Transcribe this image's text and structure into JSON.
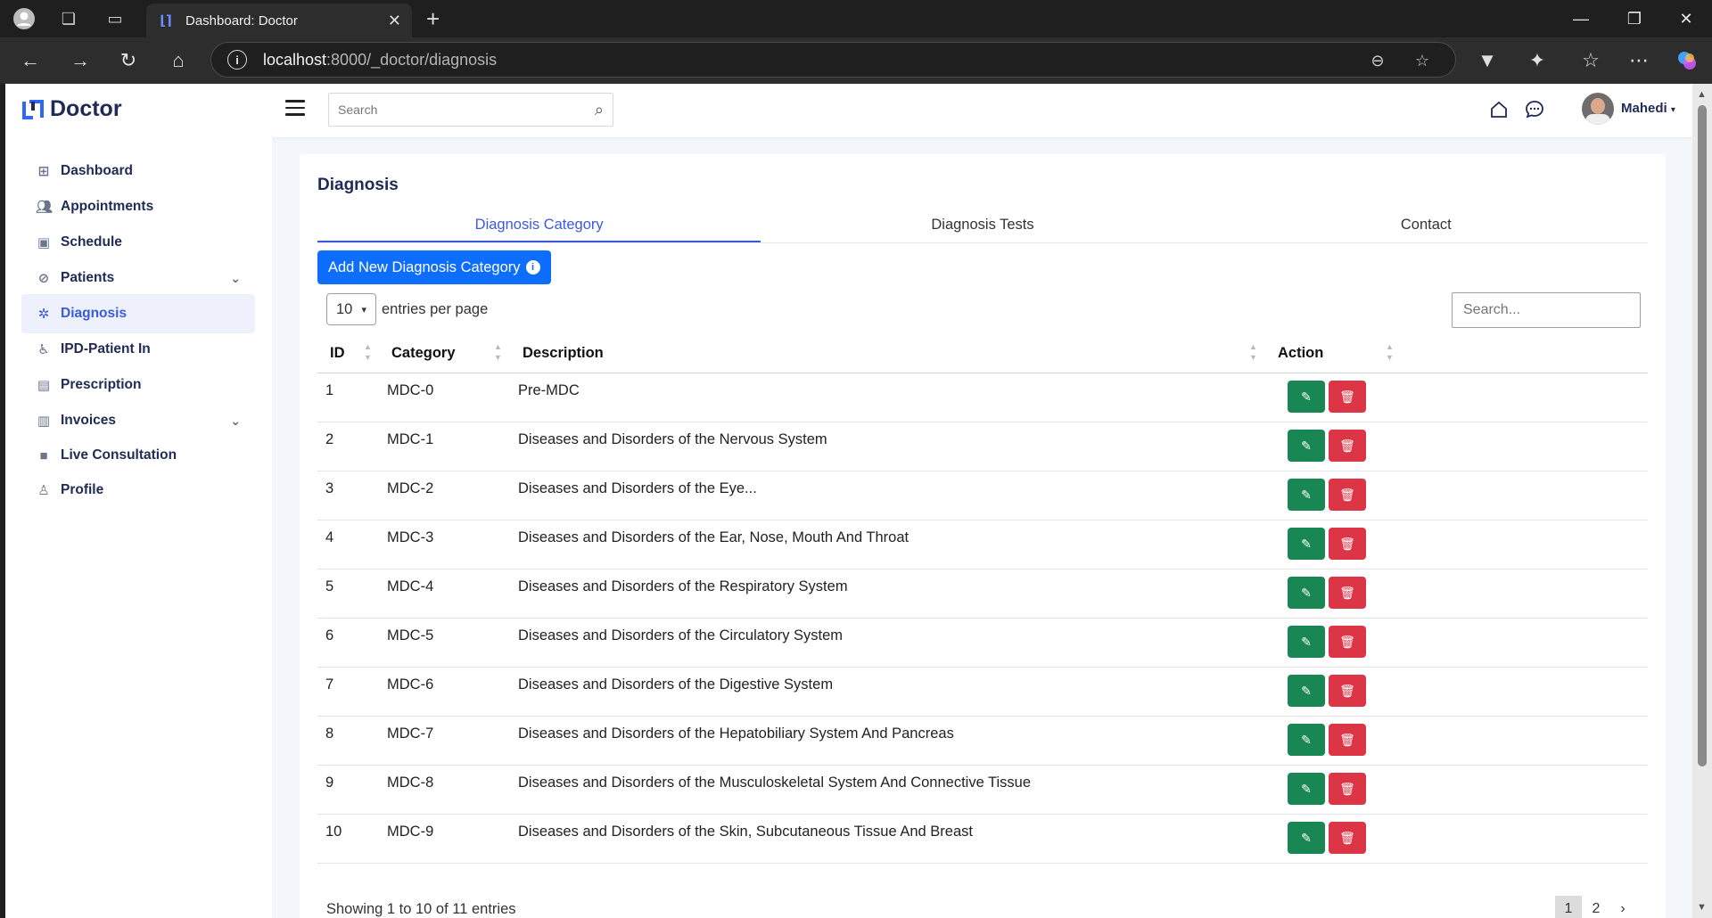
{
  "browser": {
    "tab_title": "Dashboard: Doctor",
    "url_host": "localhost",
    "url_path": ":8000/_doctor/diagnosis"
  },
  "app": {
    "brand": "Doctor",
    "search_placeholder": "Search",
    "user_name": "Mahedi"
  },
  "sidebar": {
    "items": [
      {
        "label": "Dashboard",
        "icon": "grid-icon"
      },
      {
        "label": "Appointments",
        "icon": "users-icon"
      },
      {
        "label": "Schedule",
        "icon": "calendar-icon"
      },
      {
        "label": "Patients",
        "icon": "bandage-icon"
      },
      {
        "label": "Diagnosis",
        "icon": "virus-icon"
      },
      {
        "label": "IPD-Patient In",
        "icon": "wheelchair-icon"
      },
      {
        "label": "Prescription",
        "icon": "prescription-icon"
      },
      {
        "label": "Invoices",
        "icon": "invoice-icon"
      },
      {
        "label": "Live Consultation",
        "icon": "video-icon"
      },
      {
        "label": "Profile",
        "icon": "user-icon"
      }
    ]
  },
  "page": {
    "title": "Diagnosis",
    "tabs": [
      "Diagnosis Category",
      "Diagnosis Tests",
      "Contact"
    ],
    "add_button": "Add New Diagnosis Category",
    "per_page_value": "10",
    "per_page_label": "entries per page",
    "table_search_placeholder": "Search...",
    "columns": [
      "ID",
      "Category",
      "Description",
      "Action"
    ],
    "rows": [
      {
        "id": "1",
        "category": "MDC-0",
        "description": "Pre-MDC"
      },
      {
        "id": "2",
        "category": "MDC-1",
        "description": "Diseases and Disorders of the Nervous System"
      },
      {
        "id": "3",
        "category": "MDC-2",
        "description": "Diseases and Disorders of the Eye..."
      },
      {
        "id": "4",
        "category": "MDC-3",
        "description": "Diseases and Disorders of the Ear, Nose, Mouth And Throat"
      },
      {
        "id": "5",
        "category": "MDC-4",
        "description": "Diseases and Disorders of the Respiratory System"
      },
      {
        "id": "6",
        "category": "MDC-5",
        "description": "Diseases and Disorders of the Circulatory System"
      },
      {
        "id": "7",
        "category": "MDC-6",
        "description": "Diseases and Disorders of the Digestive System"
      },
      {
        "id": "8",
        "category": "MDC-7",
        "description": "Diseases and Disorders of the Hepatobiliary System And Pancreas"
      },
      {
        "id": "9",
        "category": "MDC-8",
        "description": "Diseases and Disorders of the Musculoskeletal System And Connective Tissue"
      },
      {
        "id": "10",
        "category": "MDC-9",
        "description": "Diseases and Disorders of the Skin, Subcutaneous Tissue And Breast"
      }
    ],
    "footer_info": "Showing 1 to 10 of 11 entries",
    "pages": [
      "1",
      "2",
      "›"
    ]
  },
  "colors": {
    "accent": "#3b5bdb",
    "primary_button": "#0d6efd",
    "edit_button": "#198754",
    "delete_button": "#dc3545"
  }
}
